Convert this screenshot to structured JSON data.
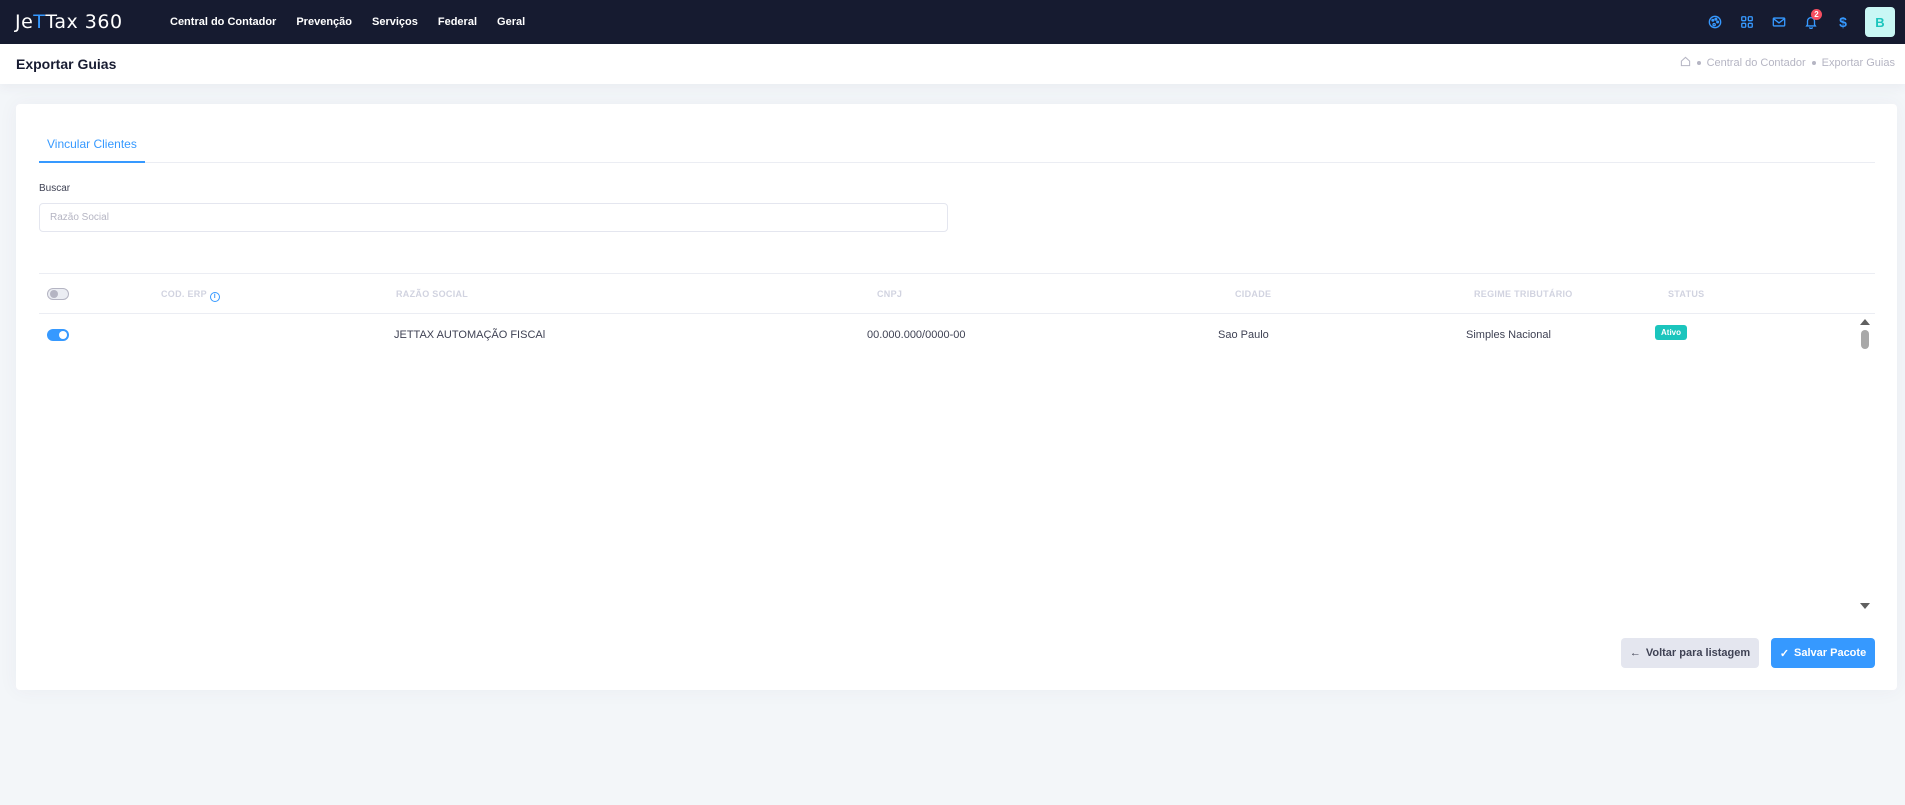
{
  "brand": {
    "logo_prefix": "Je",
    "logo_accent": "T",
    "logo_suffix": "Tax 360"
  },
  "nav": {
    "items": [
      {
        "label": "Central do Contador"
      },
      {
        "label": "Prevenção"
      },
      {
        "label": "Serviços"
      },
      {
        "label": "Federal"
      },
      {
        "label": "Geral"
      }
    ]
  },
  "topbar": {
    "icons": [
      "palette-icon",
      "apps-grid-icon",
      "mail-icon",
      "bell-icon",
      "dollar-icon"
    ],
    "notification_count": "2",
    "dollar_symbol": "$",
    "avatar_initial": "B"
  },
  "subheader": {
    "title": "Exportar Guias",
    "breadcrumb": [
      "Central do Contador",
      "Exportar Guias"
    ]
  },
  "tabs": [
    {
      "label": "Vincular Clientes"
    }
  ],
  "search": {
    "label": "Buscar",
    "placeholder": "Razão Social",
    "value": ""
  },
  "table": {
    "columns": [
      "COD. ERP",
      "RAZÃO SOCIAL",
      "CNPJ",
      "CIDADE",
      "REGIME TRIBUTÁRIO",
      "STATUS"
    ],
    "select_all_checked": false,
    "rows": [
      {
        "selected": true,
        "cod_erp": "",
        "razao_social": "JETTAX AUTOMAÇÃO FISCAl",
        "cnpj": "00.000.000/0000-00",
        "cidade": "Sao Paulo",
        "regime": "Simples Nacional",
        "status": "Ativo"
      }
    ]
  },
  "buttons": {
    "back": "Voltar para listagem",
    "save": "Salvar Pacote"
  },
  "colors": {
    "primary": "#3699ff",
    "navbar": "#161b30",
    "success": "#1bc5bd",
    "danger": "#f64e60"
  }
}
